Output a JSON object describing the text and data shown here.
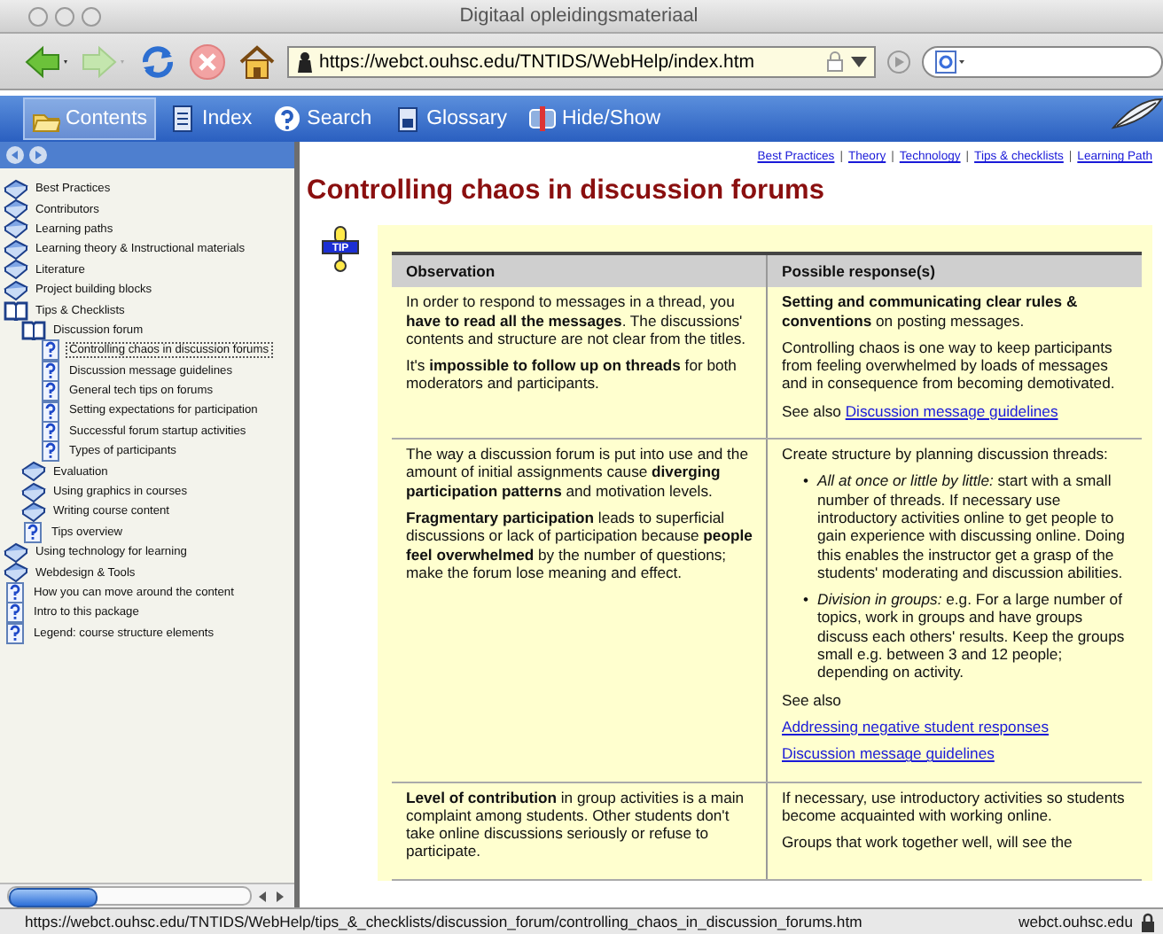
{
  "window": {
    "title": "Digitaal opleidingsmateriaal"
  },
  "toolbar": {
    "url": "https://webct.ouhsc.edu/TNTIDS/WebHelp/index.htm"
  },
  "tabs": [
    {
      "label": "Contents",
      "selected": true
    },
    {
      "label": "Index",
      "selected": false
    },
    {
      "label": "Search",
      "selected": false
    },
    {
      "label": "Glossary",
      "selected": false
    },
    {
      "label": "Hide/Show",
      "selected": false
    }
  ],
  "sidebar": {
    "tree": [
      {
        "label": "Best Practices",
        "kind": "book",
        "expanded": false,
        "selected": false
      },
      {
        "label": "Contributors",
        "kind": "book",
        "expanded": false,
        "selected": false
      },
      {
        "label": "Learning paths",
        "kind": "book",
        "expanded": false,
        "selected": false
      },
      {
        "label": "Learning theory & Instructional materials",
        "kind": "book",
        "expanded": false,
        "selected": false
      },
      {
        "label": "Literature",
        "kind": "book",
        "expanded": false,
        "selected": false
      },
      {
        "label": "Project building blocks",
        "kind": "book",
        "expanded": false,
        "selected": false
      },
      {
        "label": "Tips & Checklists",
        "kind": "book",
        "expanded": true,
        "selected": false,
        "children": [
          {
            "label": "Discussion forum",
            "kind": "book",
            "expanded": true,
            "selected": false,
            "children": [
              {
                "label": "Controlling chaos in discussion forums",
                "kind": "page",
                "selected": true
              },
              {
                "label": "Discussion message guidelines",
                "kind": "page",
                "selected": false
              },
              {
                "label": "General tech tips on forums",
                "kind": "page",
                "selected": false
              },
              {
                "label": "Setting expectations for participation",
                "kind": "page",
                "selected": false
              },
              {
                "label": "Successful forum startup activities",
                "kind": "page",
                "selected": false
              },
              {
                "label": "Types of participants",
                "kind": "page",
                "selected": false
              }
            ]
          },
          {
            "label": "Evaluation",
            "kind": "book",
            "expanded": false,
            "selected": false
          },
          {
            "label": "Using graphics in courses",
            "kind": "book",
            "expanded": false,
            "selected": false
          },
          {
            "label": "Writing course content",
            "kind": "book",
            "expanded": false,
            "selected": false
          },
          {
            "label": "Tips overview",
            "kind": "page",
            "selected": false
          }
        ]
      },
      {
        "label": "Using technology for learning",
        "kind": "book",
        "expanded": false,
        "selected": false
      },
      {
        "label": "Webdesign & Tools",
        "kind": "book",
        "expanded": false,
        "selected": false
      },
      {
        "label": "How you can move around the content",
        "kind": "page",
        "selected": false
      },
      {
        "label": "Intro to this package",
        "kind": "page",
        "selected": false
      },
      {
        "label": "Legend: course structure elements",
        "kind": "page",
        "selected": false
      }
    ]
  },
  "topic": {
    "nav_links": [
      "Best Practices",
      "Theory",
      "Technology",
      "Tips & checklists",
      "Learning Path"
    ],
    "nav_separators": [
      "|",
      "|",
      "|",
      "|"
    ],
    "title": "Controlling chaos in discussion forums",
    "tip_badge": "TIP",
    "table": {
      "columns": [
        "Observation",
        "Possible response(s)"
      ],
      "rows": [
        [
          [
            {
              "kind": "p",
              "text": "In order to respond to messages in a thread, you **have to read all the messages**. The discussions' contents and structure are not clear from the titles."
            },
            {
              "kind": "p",
              "text": "It's **impossible to follow up on threads** for both moderators and participants."
            }
          ],
          [
            {
              "kind": "p",
              "text": "**Setting and communicating clear rules & conventions** on posting messages."
            },
            {
              "kind": "p",
              "text": "Controlling chaos is one way to keep participants from feeling overwhelmed by loads of messages and in consequence from becoming demotivated."
            },
            {
              "kind": "p",
              "text": "See also",
              "link": "Discussion message guidelines"
            }
          ]
        ],
        [
          [
            {
              "kind": "p",
              "text": "The way a discussion forum is put into use and the amount of initial assignments cause **diverging participation patterns** and motivation levels."
            },
            {
              "kind": "p",
              "text": "**Fragmentary participation** leads to superficial discussions or lack of participation because **people feel overwhelmed** by the number of questions; make the forum lose meaning and effect."
            }
          ],
          [
            {
              "kind": "p",
              "text": "Create structure by planning discussion threads:"
            },
            {
              "kind": "list",
              "items": [
                {
                  "bullet": "•",
                  "text": "*All at once or little by little:* start with a small number of threads. If necessary use introductory activities online to get people to gain experience with discussing online. Doing this enables the instructor get a grasp of the students' moderating and discussion abilities."
                },
                {
                  "bullet": "•",
                  "text": "*Division in groups:* e.g. For a large number of topics, work in groups and have groups discuss each others' results. Keep the groups small e.g. between 3 and 12 people; depending on activity."
                }
              ]
            },
            {
              "kind": "p",
              "text": "See also"
            },
            {
              "kind": "link",
              "text": "Addressing negative student responses"
            },
            {
              "kind": "link",
              "text": "Discussion message guidelines"
            }
          ]
        ],
        [
          [
            {
              "kind": "p",
              "text": "**Level of contribution** in group activities is a main complaint among students. Other students don't take online discussions seriously or refuse to participate."
            }
          ],
          [
            {
              "kind": "p",
              "text": "If necessary, use introductory activities so students become acquainted with working online."
            },
            {
              "kind": "p",
              "text": "Groups that work together well, will see the"
            }
          ]
        ]
      ]
    }
  },
  "status_bar": {
    "url": "https://webct.ouhsc.edu/TNTIDS/WebHelp/tips_&_checklists/discussion_forum/controlling_chaos_in_discussion_forums.htm",
    "domain": "webct.ouhsc.edu"
  }
}
